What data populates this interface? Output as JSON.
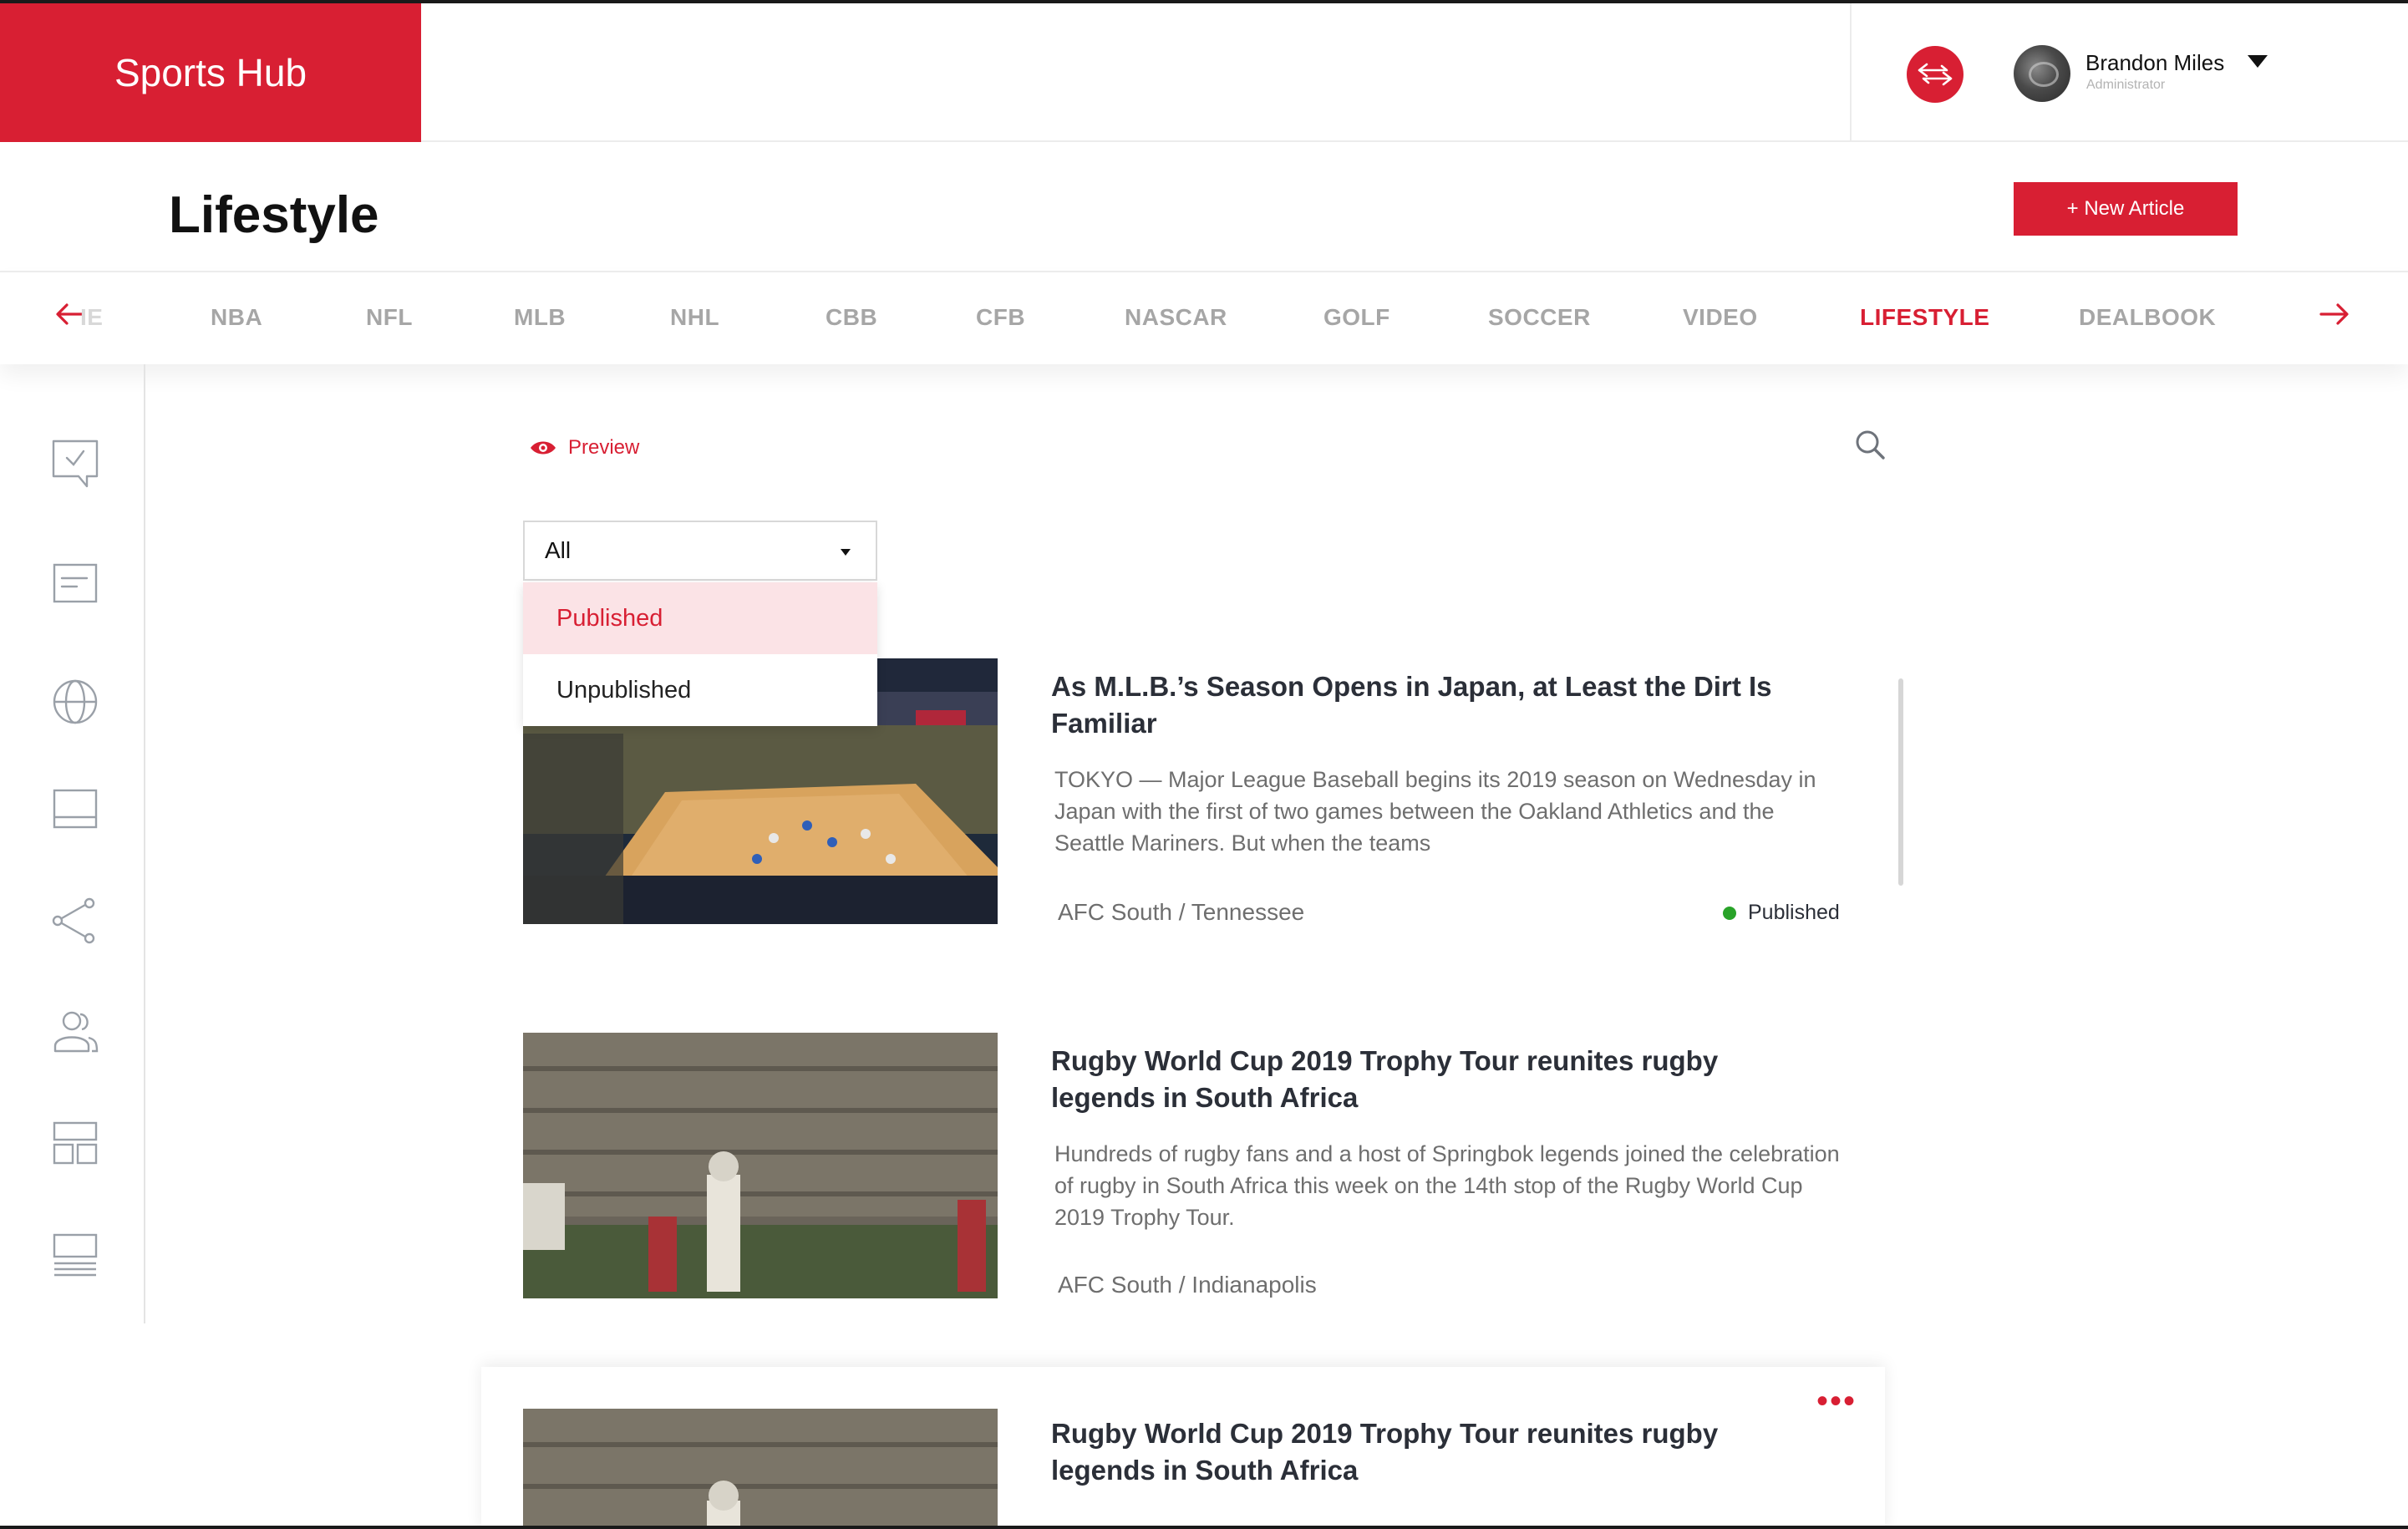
{
  "app": {
    "logo": "Sports Hub"
  },
  "user": {
    "name": "Brandon Miles",
    "role": "Administrator"
  },
  "page": {
    "title": "Lifestyle",
    "new_article_label": "+ New Article"
  },
  "categories": [
    {
      "label": "IE",
      "state": "faded"
    },
    {
      "label": "NBA"
    },
    {
      "label": "NFL"
    },
    {
      "label": "MLB"
    },
    {
      "label": "NHL"
    },
    {
      "label": "CBB"
    },
    {
      "label": "CFB"
    },
    {
      "label": "NASCAR"
    },
    {
      "label": "GOLF"
    },
    {
      "label": "SOCCER"
    },
    {
      "label": "VIDEO"
    },
    {
      "label": "LIFESTYLE",
      "state": "active"
    },
    {
      "label": "DEALBOOK"
    }
  ],
  "toolbar": {
    "preview_label": "Preview"
  },
  "filter": {
    "selected": "All",
    "options": [
      "Published",
      "Unpublished"
    ],
    "highlighted": "Published"
  },
  "articles": [
    {
      "title": "As M.L.B.’s Season Opens in Japan, at Least the Dirt Is Familiar",
      "description": "TOKYO — Major League Baseball begins its 2019 season on Wednesday in Japan with the first of two games between the Oakland Athletics and the Seattle Mariners. But when the teams",
      "category": "AFC South / Tennessee",
      "status": "Published",
      "image": "basketball-arena-photo"
    },
    {
      "title": "Rugby World Cup 2019 Trophy Tour reunites rugby legends in South Africa",
      "description": "Hundreds of rugby fans and a host of Springbok legends joined the celebration of rugby in South Africa this week on the 14th stop of the Rugby World Cup 2019 Trophy Tour.",
      "category": "AFC South / Indianapolis",
      "image": "football-game-photo"
    },
    {
      "title": "Rugby World Cup 2019 Trophy Tour reunites rugby legends in South Africa",
      "image": "football-game-photo"
    }
  ],
  "colors": {
    "accent": "#d81f33",
    "published": "#29a329",
    "nav_inactive": "#a6a6a6"
  },
  "icons": {
    "sidebar": [
      "checklist-icon",
      "article-icon",
      "globe-icon",
      "layout-icon",
      "share-icon",
      "users-icon",
      "dashboard-icon",
      "list-icon"
    ]
  }
}
